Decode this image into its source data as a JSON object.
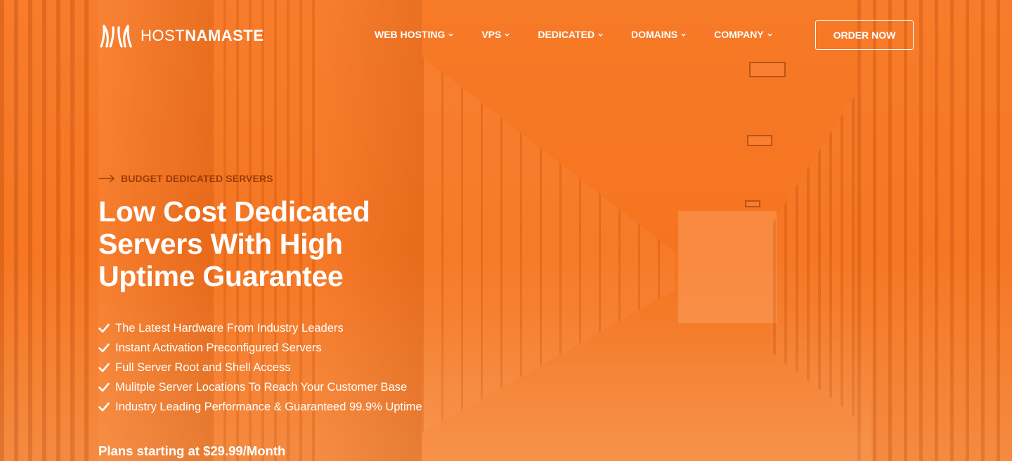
{
  "brand": {
    "logo_host": "HOST",
    "logo_namaste": "NAMASTE",
    "logo_icon": "namaste-hands-icon"
  },
  "nav": {
    "items": [
      {
        "label": "WEB HOSTING",
        "icon": "chevron-down-icon"
      },
      {
        "label": "VPS",
        "icon": "chevron-down-icon"
      },
      {
        "label": "DEDICATED",
        "icon": "chevron-down-icon"
      },
      {
        "label": "DOMAINS",
        "icon": "chevron-down-icon"
      },
      {
        "label": "COMPANY",
        "icon": "chevron-down-icon"
      }
    ],
    "order_label": "ORDER NOW"
  },
  "hero": {
    "eyebrow": "BUDGET DEDICATED SERVERS",
    "eyebrow_icon": "arrow-right-icon",
    "headline_lines": [
      "Low Cost Dedicated",
      "Servers With High",
      "Uptime Guarantee"
    ],
    "features": [
      "The Latest Hardware From Industry Leaders",
      "Instant Activation Preconfigured Servers",
      "Full Server Root and Shell Access",
      "Mulitple Server Locations To Reach Your Customer Base",
      "Industry Leading Performance & Guaranteed 99.9% Uptime"
    ],
    "feature_icon": "check-icon",
    "pricing_prefix": "Plans starting at",
    "pricing_value": "$29.99/Month"
  },
  "colors": {
    "accent": "#f5741f",
    "eyebrow": "#9b3a04",
    "text": "#ffffff"
  }
}
